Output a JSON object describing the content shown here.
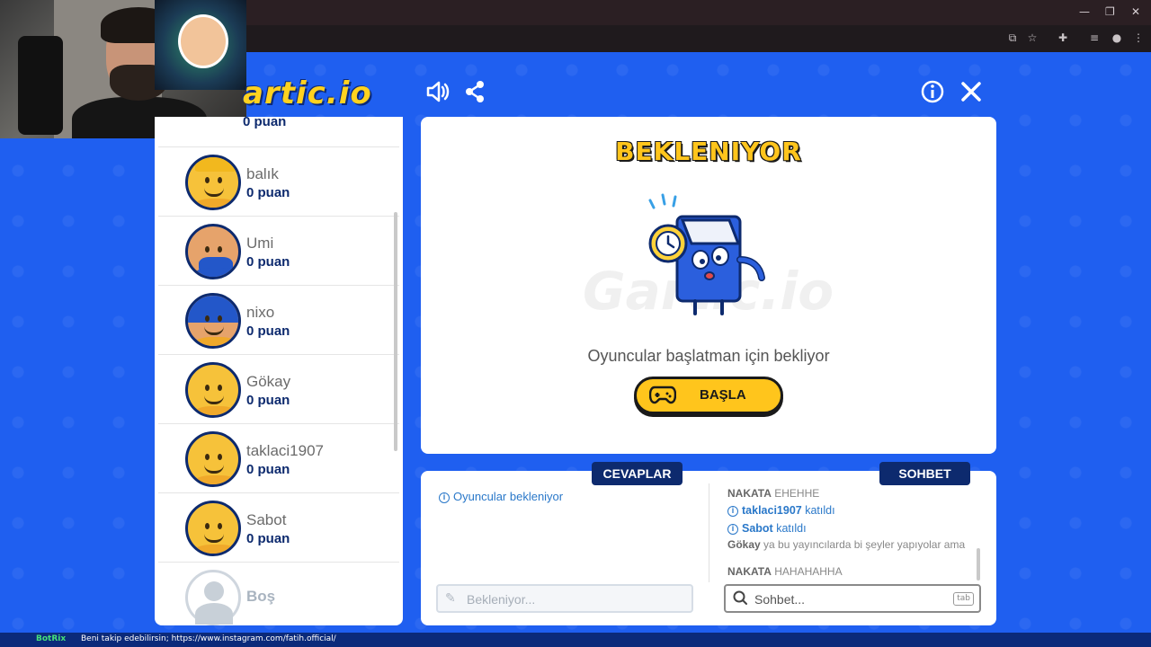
{
  "browser": {
    "window_controls": [
      "—",
      "❐",
      "✕"
    ],
    "toolbar_icons": [
      "cast-icon",
      "star-icon",
      "extensions-icon",
      "media-icon",
      "profile-icon",
      "menu-icon"
    ]
  },
  "logo": {
    "text": "artic.io"
  },
  "players": {
    "partial_top_points": "0 puan",
    "items": [
      {
        "name": "balık",
        "points": "0 puan",
        "avatar": "cap"
      },
      {
        "name": "Umi",
        "points": "0 puan",
        "avatar": "beard"
      },
      {
        "name": "nixo",
        "points": "0 puan",
        "avatar": "bluehair"
      },
      {
        "name": "Gökay",
        "points": "0 puan",
        "avatar": "plain"
      },
      {
        "name": "taklaci1907",
        "points": "0 puan",
        "avatar": "plain"
      },
      {
        "name": "Sabot",
        "points": "0 puan",
        "avatar": "plain"
      }
    ],
    "empty_slot": {
      "name": "Boş"
    }
  },
  "main": {
    "title": "BEKLENIYOR",
    "watermark": "Gartic.io",
    "waiting_message": "Oyuncular başlatman için bekliyor",
    "start_button": "BAŞLA"
  },
  "bottom": {
    "answers_tab": "CEVAPLAR",
    "chat_tab": "SOHBET",
    "answers_info": "Oyuncular bekleniyor",
    "chat": [
      {
        "type": "msg",
        "who": "NAKATA",
        "text": "EHEHHE"
      },
      {
        "type": "info",
        "who": "taklaci1907",
        "text": "katıldı"
      },
      {
        "type": "info",
        "who": "Sabot",
        "text": "katıldı"
      },
      {
        "type": "msg",
        "who": "Gökay",
        "text": "ya bu yayıncılarda bi şeyler yapıyolar ama"
      },
      {
        "type": "msg",
        "who": "NAKATA",
        "text": "HAHAHAHHA"
      }
    ],
    "answer_placeholder": "Bekleniyor...",
    "chat_placeholder": "Sohbet...",
    "tab_key": "tab"
  },
  "ticker": {
    "bot": "BotRix",
    "message": "Beni takip edebilirsin; https://www.instagram.com/fatih.official/"
  },
  "colors": {
    "background": "#1f5ff0",
    "accent_yellow": "#ffc51c",
    "navy": "#0d2a6e",
    "info_blue": "#2a78c9"
  }
}
